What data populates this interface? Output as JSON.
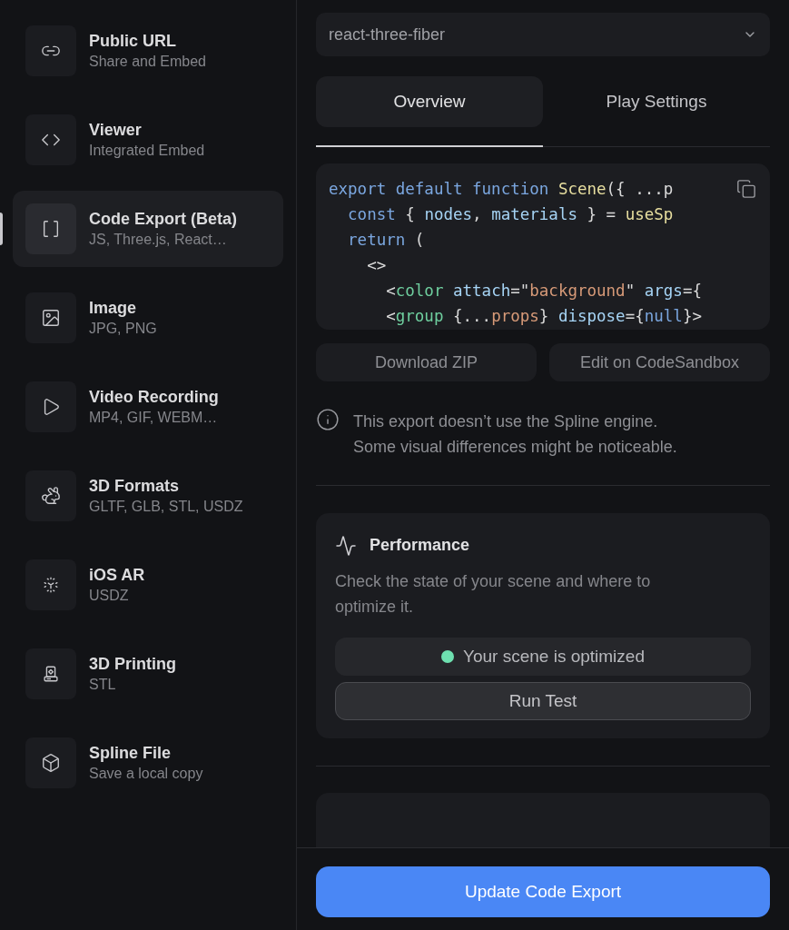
{
  "sidebar": {
    "items": [
      {
        "title": "Public URL",
        "subtitle": "Share and Embed",
        "selected": false
      },
      {
        "title": "Viewer",
        "subtitle": "Integrated Embed",
        "selected": false
      },
      {
        "title": "Code Export (Beta)",
        "subtitle": "JS, Three.js, React…",
        "selected": true
      },
      {
        "title": "Image",
        "subtitle": "JPG, PNG",
        "selected": false
      },
      {
        "title": "Video Recording",
        "subtitle": "MP4, GIF, WEBM…",
        "selected": false
      },
      {
        "title": "3D Formats",
        "subtitle": "GLTF, GLB, STL, USDZ",
        "selected": false
      },
      {
        "title": "iOS AR",
        "subtitle": "USDZ",
        "selected": false
      },
      {
        "title": "3D Printing",
        "subtitle": "STL",
        "selected": false
      },
      {
        "title": "Spline File",
        "subtitle": "Save a local copy",
        "selected": false
      }
    ]
  },
  "framework_select": {
    "value": "react-three-fiber"
  },
  "tabs": [
    {
      "label": "Overview",
      "selected": true
    },
    {
      "label": "Play Settings",
      "selected": false
    }
  ],
  "code": {
    "lines": [
      [
        {
          "kind": "keyword",
          "text": "export default function "
        },
        {
          "kind": "func",
          "text": "Scene"
        },
        {
          "kind": "punct",
          "text": "({ ...p"
        }
      ],
      [
        {
          "kind": "keyword",
          "text": "  const "
        },
        {
          "kind": "punct",
          "text": "{ "
        },
        {
          "kind": "var",
          "text": "nodes"
        },
        {
          "kind": "punct",
          "text": ", "
        },
        {
          "kind": "var",
          "text": "materials"
        },
        {
          "kind": "punct",
          "text": " } = "
        },
        {
          "kind": "func",
          "text": "useSp"
        }
      ],
      [
        {
          "kind": "keyword",
          "text": "  return"
        },
        {
          "kind": "punct",
          "text": " ("
        }
      ],
      [
        {
          "kind": "punct",
          "text": "    <>"
        }
      ],
      [
        {
          "kind": "punct",
          "text": "      <"
        },
        {
          "kind": "tag",
          "text": "color"
        },
        {
          "kind": "var",
          "text": " attach"
        },
        {
          "kind": "punct",
          "text": "=\""
        },
        {
          "kind": "string",
          "text": "background"
        },
        {
          "kind": "punct",
          "text": "\" "
        },
        {
          "kind": "var",
          "text": "args"
        },
        {
          "kind": "punct",
          "text": "={"
        }
      ],
      [
        {
          "kind": "punct",
          "text": "      <"
        },
        {
          "kind": "tag",
          "text": "group"
        },
        {
          "kind": "punct",
          "text": " {..."
        },
        {
          "kind": "string",
          "text": "props"
        },
        {
          "kind": "punct",
          "text": "} "
        },
        {
          "kind": "var",
          "text": "dispose"
        },
        {
          "kind": "punct",
          "text": "={"
        },
        {
          "kind": "keyword",
          "text": "null"
        },
        {
          "kind": "punct",
          "text": "}>"
        }
      ]
    ]
  },
  "actions": [
    "Download ZIP",
    "Edit on CodeSandbox"
  ],
  "notice": {
    "lines": [
      "This export doesn’t use the Spline engine.",
      "Some visual differences might be noticeable."
    ]
  },
  "performance": {
    "title": "Performance",
    "description": "Check the state of your scene and where to optimize it.",
    "status": {
      "text": "Your scene is optimized",
      "color": "#6ee0b0"
    },
    "button": "Run Test"
  },
  "footer": {
    "button": "Update Code Export"
  }
}
